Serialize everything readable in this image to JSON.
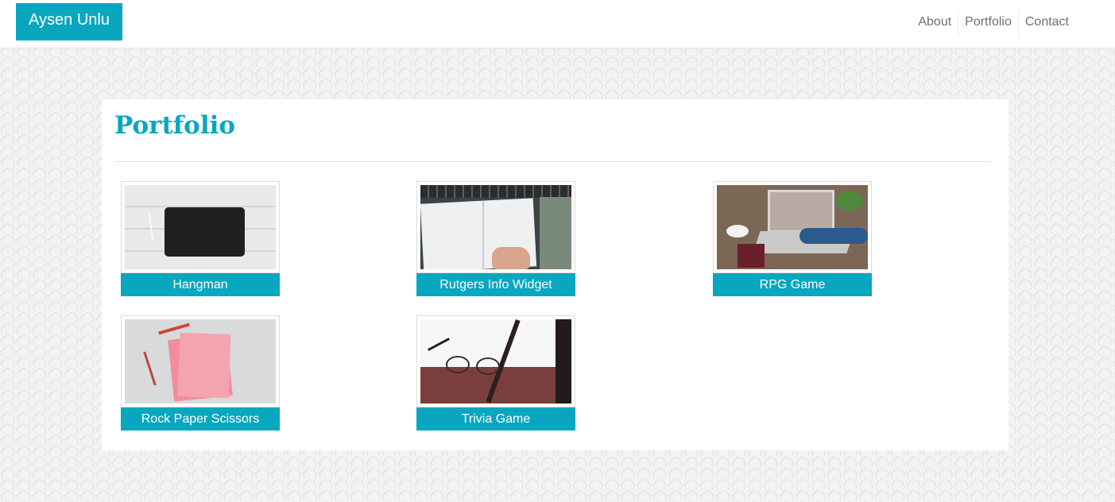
{
  "header": {
    "brand": "Aysen Unlu",
    "nav": [
      {
        "label": "About"
      },
      {
        "label": "Portfolio"
      },
      {
        "label": "Contact"
      }
    ]
  },
  "main": {
    "title": "Portfolio",
    "projects": [
      {
        "label": "Hangman",
        "image": "tablet-on-white-desk"
      },
      {
        "label": "Rutgers Info Widget",
        "image": "open-notebook-with-pen"
      },
      {
        "label": "RPG Game",
        "image": "laptop-on-wooden-table"
      },
      {
        "label": "Rock Paper Scissors",
        "image": "pink-paper-and-pencils"
      },
      {
        "label": "Trivia Game",
        "image": "eyeglasses-over-railing"
      }
    ]
  },
  "colors": {
    "accent": "#08a7bf",
    "nav_text": "#707070",
    "panel_bg": "#ffffff"
  }
}
